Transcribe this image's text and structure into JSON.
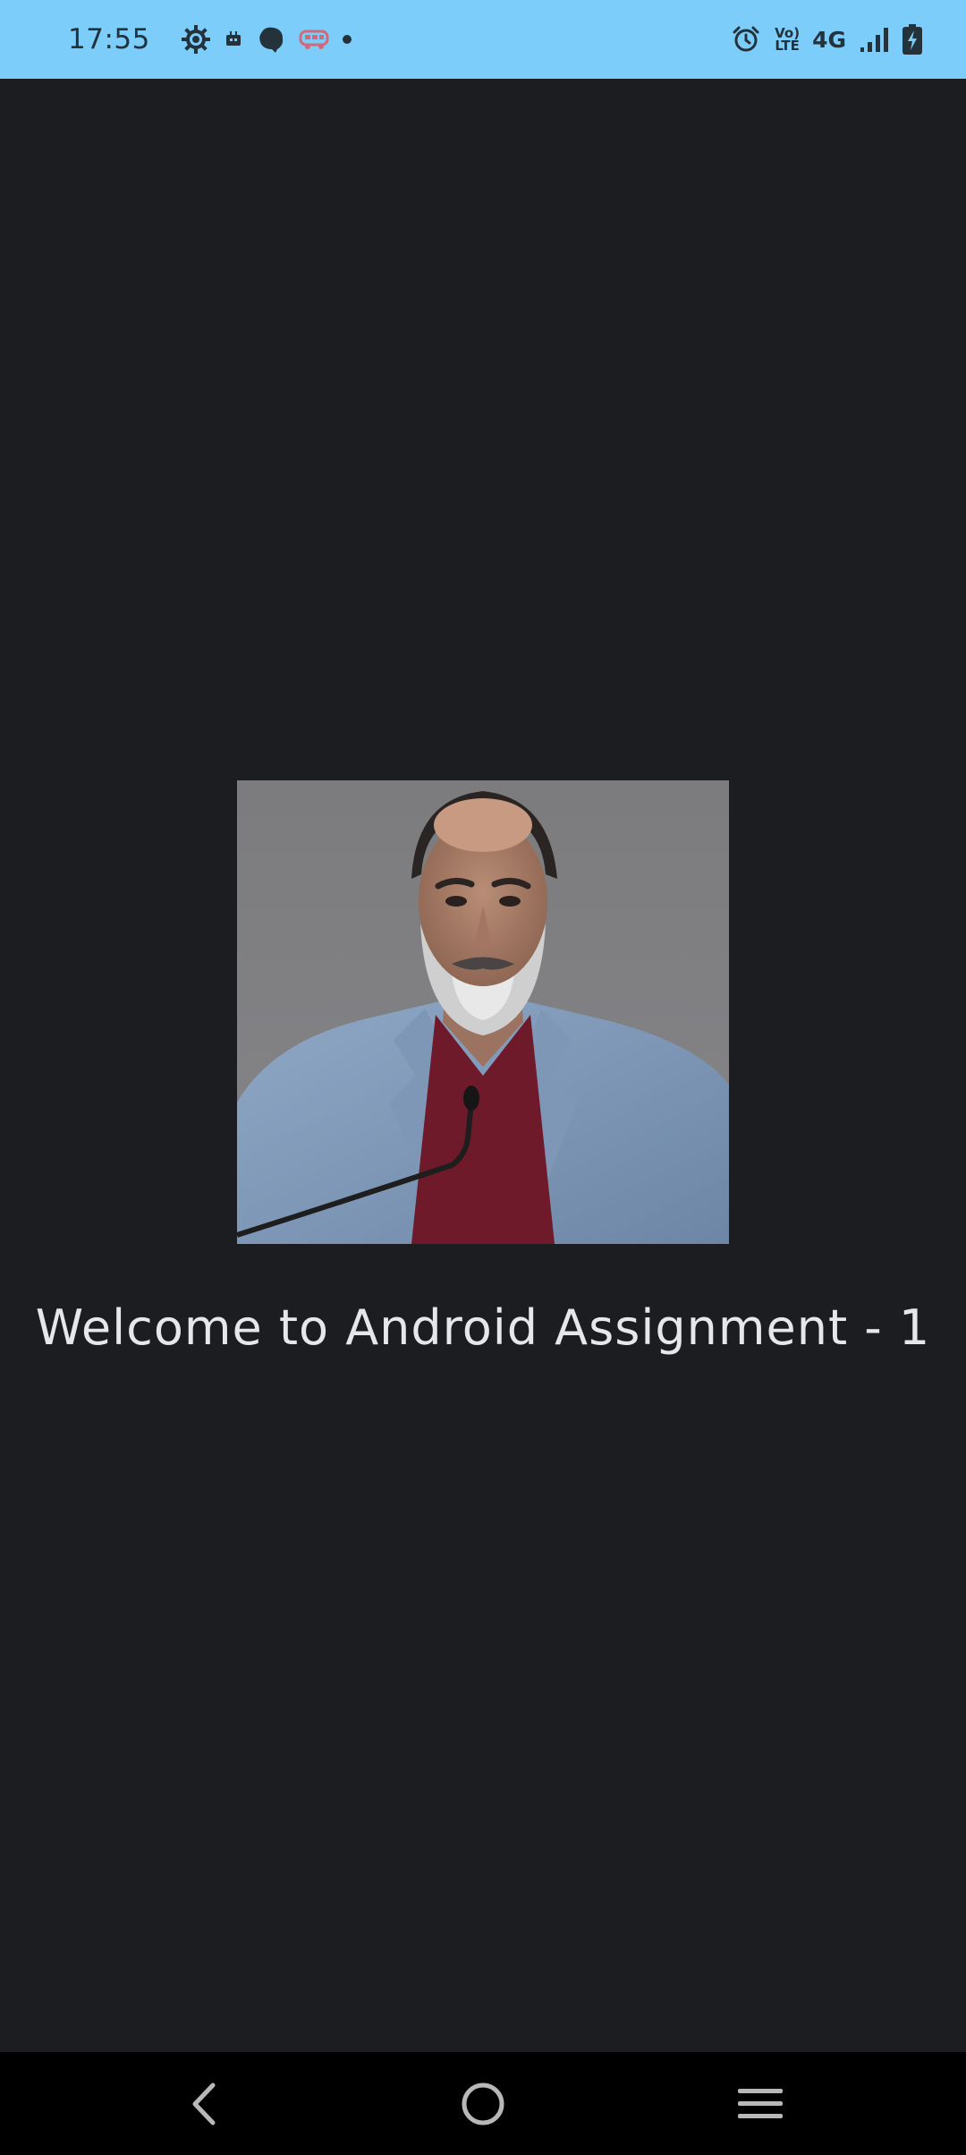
{
  "status_bar": {
    "time": "17:55",
    "network": "4G",
    "volte_top": "Vo)",
    "volte_bottom": "LTE",
    "icons_left": [
      "settings-gear-icon",
      "notification-icon",
      "app-notification-icon",
      "bus-icon",
      "more-dot-icon"
    ],
    "icons_right": [
      "alarm-icon",
      "volte-icon",
      "network-4g-icon",
      "signal-icon",
      "battery-charging-icon"
    ]
  },
  "main": {
    "welcome_text": "Welcome to Android Assignment - 1"
  },
  "nav_bar": {
    "buttons": [
      "back-icon",
      "home-icon",
      "recents-icon"
    ]
  },
  "colors": {
    "status_bar_bg": "#7dcdfa",
    "background": "#1b1d21",
    "nav_bar_bg": "#000000",
    "text": "#e6e7ea"
  }
}
